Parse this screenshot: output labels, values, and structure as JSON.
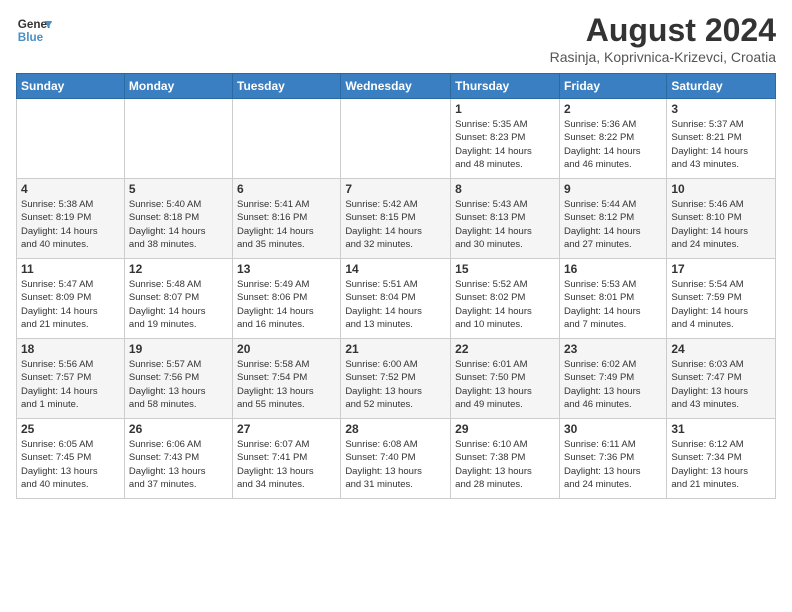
{
  "header": {
    "logo_line1": "General",
    "logo_line2": "Blue",
    "title": "August 2024",
    "subtitle": "Rasinja, Koprivnica-Krizevci, Croatia"
  },
  "days_of_week": [
    "Sunday",
    "Monday",
    "Tuesday",
    "Wednesday",
    "Thursday",
    "Friday",
    "Saturday"
  ],
  "weeks": [
    [
      {
        "day": "",
        "info": ""
      },
      {
        "day": "",
        "info": ""
      },
      {
        "day": "",
        "info": ""
      },
      {
        "day": "",
        "info": ""
      },
      {
        "day": "1",
        "info": "Sunrise: 5:35 AM\nSunset: 8:23 PM\nDaylight: 14 hours\nand 48 minutes."
      },
      {
        "day": "2",
        "info": "Sunrise: 5:36 AM\nSunset: 8:22 PM\nDaylight: 14 hours\nand 46 minutes."
      },
      {
        "day": "3",
        "info": "Sunrise: 5:37 AM\nSunset: 8:21 PM\nDaylight: 14 hours\nand 43 minutes."
      }
    ],
    [
      {
        "day": "4",
        "info": "Sunrise: 5:38 AM\nSunset: 8:19 PM\nDaylight: 14 hours\nand 40 minutes."
      },
      {
        "day": "5",
        "info": "Sunrise: 5:40 AM\nSunset: 8:18 PM\nDaylight: 14 hours\nand 38 minutes."
      },
      {
        "day": "6",
        "info": "Sunrise: 5:41 AM\nSunset: 8:16 PM\nDaylight: 14 hours\nand 35 minutes."
      },
      {
        "day": "7",
        "info": "Sunrise: 5:42 AM\nSunset: 8:15 PM\nDaylight: 14 hours\nand 32 minutes."
      },
      {
        "day": "8",
        "info": "Sunrise: 5:43 AM\nSunset: 8:13 PM\nDaylight: 14 hours\nand 30 minutes."
      },
      {
        "day": "9",
        "info": "Sunrise: 5:44 AM\nSunset: 8:12 PM\nDaylight: 14 hours\nand 27 minutes."
      },
      {
        "day": "10",
        "info": "Sunrise: 5:46 AM\nSunset: 8:10 PM\nDaylight: 14 hours\nand 24 minutes."
      }
    ],
    [
      {
        "day": "11",
        "info": "Sunrise: 5:47 AM\nSunset: 8:09 PM\nDaylight: 14 hours\nand 21 minutes."
      },
      {
        "day": "12",
        "info": "Sunrise: 5:48 AM\nSunset: 8:07 PM\nDaylight: 14 hours\nand 19 minutes."
      },
      {
        "day": "13",
        "info": "Sunrise: 5:49 AM\nSunset: 8:06 PM\nDaylight: 14 hours\nand 16 minutes."
      },
      {
        "day": "14",
        "info": "Sunrise: 5:51 AM\nSunset: 8:04 PM\nDaylight: 14 hours\nand 13 minutes."
      },
      {
        "day": "15",
        "info": "Sunrise: 5:52 AM\nSunset: 8:02 PM\nDaylight: 14 hours\nand 10 minutes."
      },
      {
        "day": "16",
        "info": "Sunrise: 5:53 AM\nSunset: 8:01 PM\nDaylight: 14 hours\nand 7 minutes."
      },
      {
        "day": "17",
        "info": "Sunrise: 5:54 AM\nSunset: 7:59 PM\nDaylight: 14 hours\nand 4 minutes."
      }
    ],
    [
      {
        "day": "18",
        "info": "Sunrise: 5:56 AM\nSunset: 7:57 PM\nDaylight: 14 hours\nand 1 minute."
      },
      {
        "day": "19",
        "info": "Sunrise: 5:57 AM\nSunset: 7:56 PM\nDaylight: 13 hours\nand 58 minutes."
      },
      {
        "day": "20",
        "info": "Sunrise: 5:58 AM\nSunset: 7:54 PM\nDaylight: 13 hours\nand 55 minutes."
      },
      {
        "day": "21",
        "info": "Sunrise: 6:00 AM\nSunset: 7:52 PM\nDaylight: 13 hours\nand 52 minutes."
      },
      {
        "day": "22",
        "info": "Sunrise: 6:01 AM\nSunset: 7:50 PM\nDaylight: 13 hours\nand 49 minutes."
      },
      {
        "day": "23",
        "info": "Sunrise: 6:02 AM\nSunset: 7:49 PM\nDaylight: 13 hours\nand 46 minutes."
      },
      {
        "day": "24",
        "info": "Sunrise: 6:03 AM\nSunset: 7:47 PM\nDaylight: 13 hours\nand 43 minutes."
      }
    ],
    [
      {
        "day": "25",
        "info": "Sunrise: 6:05 AM\nSunset: 7:45 PM\nDaylight: 13 hours\nand 40 minutes."
      },
      {
        "day": "26",
        "info": "Sunrise: 6:06 AM\nSunset: 7:43 PM\nDaylight: 13 hours\nand 37 minutes."
      },
      {
        "day": "27",
        "info": "Sunrise: 6:07 AM\nSunset: 7:41 PM\nDaylight: 13 hours\nand 34 minutes."
      },
      {
        "day": "28",
        "info": "Sunrise: 6:08 AM\nSunset: 7:40 PM\nDaylight: 13 hours\nand 31 minutes."
      },
      {
        "day": "29",
        "info": "Sunrise: 6:10 AM\nSunset: 7:38 PM\nDaylight: 13 hours\nand 28 minutes."
      },
      {
        "day": "30",
        "info": "Sunrise: 6:11 AM\nSunset: 7:36 PM\nDaylight: 13 hours\nand 24 minutes."
      },
      {
        "day": "31",
        "info": "Sunrise: 6:12 AM\nSunset: 7:34 PM\nDaylight: 13 hours\nand 21 minutes."
      }
    ]
  ]
}
